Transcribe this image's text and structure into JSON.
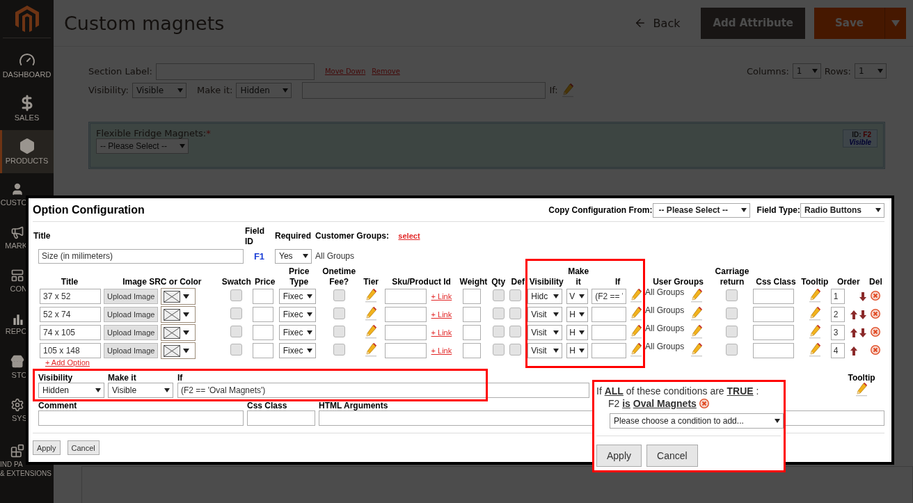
{
  "sidebar": {
    "items": [
      {
        "label": "DASHBOARD",
        "selected": false
      },
      {
        "label": "SALES",
        "selected": false
      },
      {
        "label": "PRODUCTS",
        "selected": true
      },
      {
        "label": "CUSTO",
        "selected": false
      },
      {
        "label": "MARK",
        "selected": false
      },
      {
        "label": "CON",
        "selected": false
      },
      {
        "label": "REPO",
        "selected": false
      },
      {
        "label": "STO",
        "selected": false
      },
      {
        "label": "SYS",
        "selected": false
      },
      {
        "label": "IND PA\n& EXTENSIONS",
        "selected": false
      }
    ]
  },
  "header": {
    "title": "Custom magnets",
    "back": "Back",
    "add_attribute": "Add Attribute",
    "save": "Save"
  },
  "section": {
    "label": "Section Label:",
    "move_down": "Move Down",
    "remove": "Remove",
    "columns_label": "Columns:",
    "columns": "1",
    "rows_label": "Rows:",
    "rows": "1",
    "visibility_label": "Visibility:",
    "visibility": "Visible",
    "make_it_label": "Make it:",
    "make_it": "Hidden",
    "if_label": "If:"
  },
  "field": {
    "label": "Flexible Fridge Magnets:",
    "required_mark": "*",
    "value": "-- Please Select --",
    "id_label": "ID:",
    "id": "F2",
    "status": "Visible"
  },
  "modal": {
    "title": "Option Configuration",
    "copy_label": "Copy Configuration From:",
    "copy_value": "-- Please Select --",
    "type_label": "Field Type:",
    "type_value": "Radio Buttons",
    "field_headers": [
      "Title",
      "Field ID",
      "Required",
      "Customer Groups:"
    ],
    "groups_link": "select",
    "title_value": "Size (in milimeters)",
    "field_id": "F1",
    "required": "Yes",
    "groups": "All Groups",
    "columns": [
      "Title",
      "Image SRC or Color",
      "Swatch",
      "Price",
      "Price Type",
      "Onetime Fee?",
      "Tier",
      "Sku/Product Id",
      "Weight",
      "Qty",
      "Def",
      "Visibility",
      "Make it",
      "If",
      "User Groups",
      "Carriage return",
      "Css Class",
      "Tooltip",
      "Order",
      "Del"
    ],
    "options": [
      {
        "title": "37 x 52",
        "upload": "Upload Image",
        "swatch": false,
        "price_type": "Fixec",
        "onetime": false,
        "link": "+ Link",
        "qty": false,
        "default": false,
        "visibility": "Hidc",
        "make_it": "V",
        "if": "(F2 == '",
        "user_groups": "All Groups",
        "carriage_return": false,
        "order": "1",
        "move_up": false,
        "move_down": true
      },
      {
        "title": "52 x 74",
        "upload": "Upload Image",
        "swatch": false,
        "price_type": "Fixec",
        "onetime": false,
        "link": "+ Link",
        "qty": false,
        "default": false,
        "visibility": "Visit",
        "make_it": "H",
        "user_groups": "All Groups",
        "carriage_return": false,
        "order": "2",
        "move_up": true,
        "move_down": true
      },
      {
        "title": "74 x 105",
        "upload": "Upload Image",
        "swatch": false,
        "price_type": "Fixec",
        "onetime": false,
        "link": "+ Link",
        "qty": false,
        "default": false,
        "visibility": "Visit",
        "make_it": "H",
        "user_groups": "All Groups",
        "carriage_return": false,
        "order": "3",
        "move_up": true,
        "move_down": true
      },
      {
        "title": "105 x 148",
        "upload": "Upload Image",
        "swatch": false,
        "price_type": "Fixec",
        "onetime": false,
        "link": "+ Link",
        "qty": false,
        "default": false,
        "visibility": "Visit",
        "make_it": "H",
        "user_groups": "All Groups",
        "carriage_return": false,
        "order": "4",
        "move_up": true,
        "move_down": false
      }
    ],
    "add_option": "+ Add Option",
    "visibility_label": "Visibility",
    "visibility": "Hidden",
    "make_it_label": "Make it",
    "make_it": "Visible",
    "if_label": "If",
    "if_value": "(F2 == 'Oval Magnets')",
    "tooltip_label": "Tooltip",
    "comment_label": "Comment",
    "css_label": "Css Class",
    "html_label": "HTML Arguments",
    "apply": "Apply",
    "cancel": "Cancel"
  },
  "conditions": {
    "intro": "If **ALL** of these conditions are **TRUE** :",
    "condition": "F2 **is** **Oval Magnets**",
    "value": "Please choose a condition to add...",
    "apply": "Apply",
    "cancel": "Cancel"
  }
}
